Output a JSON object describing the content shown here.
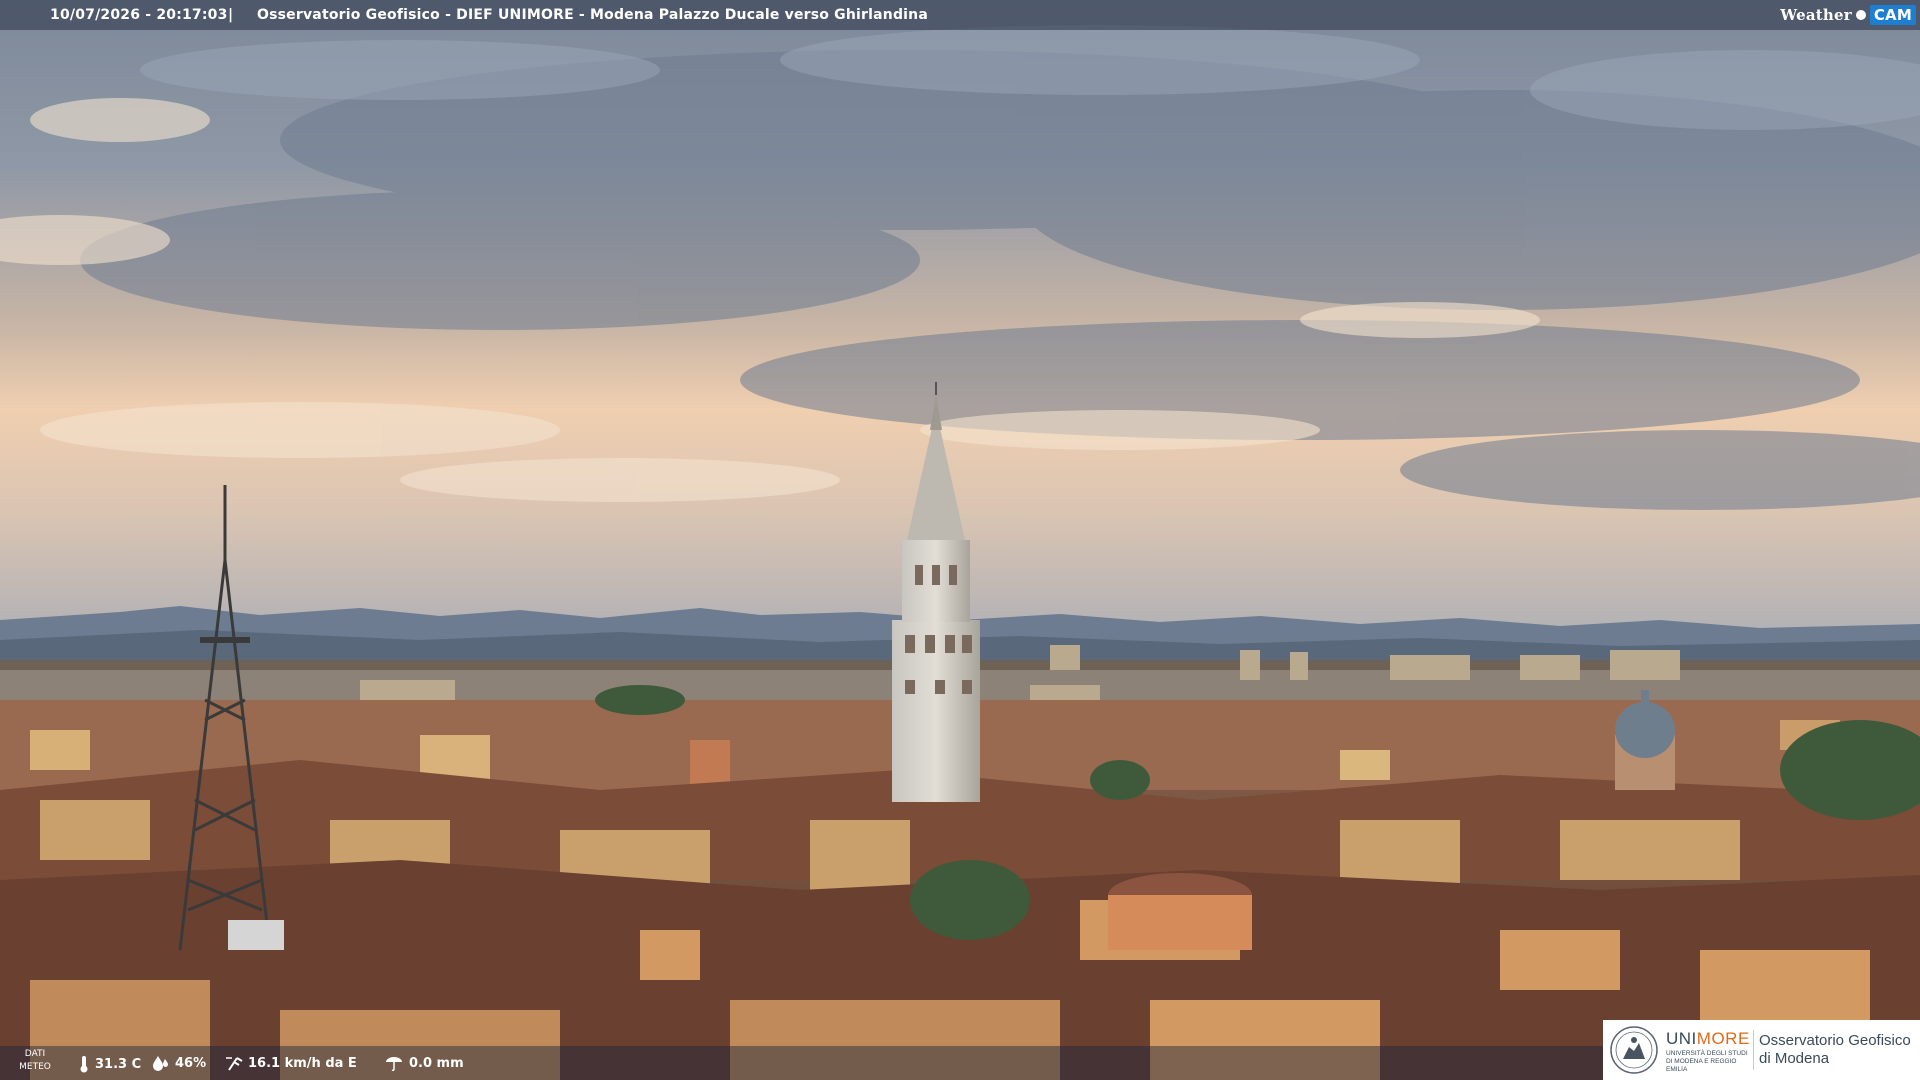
{
  "overlay": {
    "timestamp": "10/07/2026 - 20:17:03",
    "separator": "|",
    "title": "Osservatorio Geofisico - DIEF UNIMORE - Modena Palazzo Ducale verso Ghirlandina"
  },
  "brand": {
    "weather_label": "Weather",
    "cam_label": "CAM"
  },
  "weather_strip": {
    "dati_line1": "DATI",
    "dati_line2": "METEO",
    "temperature": "31.3 C",
    "humidity": "46%",
    "wind": "16.1 km/h da E",
    "rain": "0.0 mm",
    "icons": [
      "thermometer-icon",
      "humidity-drop-icon",
      "wind-icon",
      "rain-gauge-icon"
    ]
  },
  "logo": {
    "uni_part1": "UNI",
    "uni_part2": "MORE",
    "uni_sub": "UNIVERSITÀ DEGLI STUDI DI MODENA E REGGIO EMILIA",
    "obs_line1": "Osservatorio Geofisico",
    "obs_line2": "di Modena"
  },
  "colors": {
    "sky_top": "#8f9aaa",
    "sky_glow": "#f2cfae",
    "mountains": "#5e6e82",
    "roofs": "#8a5a44",
    "cam_accent": "#1e7fd0",
    "unimore_orange": "#e06a1a"
  }
}
